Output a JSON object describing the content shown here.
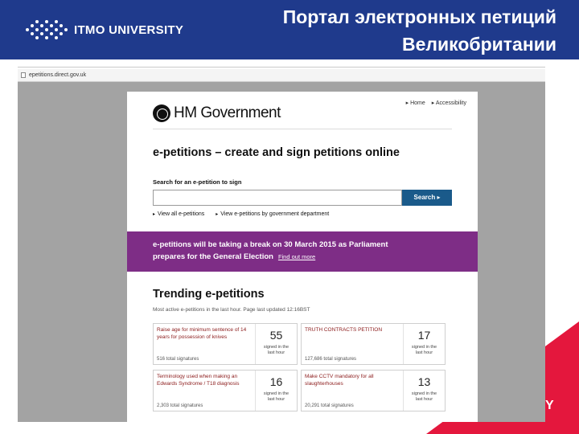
{
  "header": {
    "logo_text": "ITMO UNIVERSITY",
    "title_line1": "Портал электронных петиций",
    "title_line2": "Великобритании",
    "accent_color": "#1f3a8c",
    "corner_letter": "Y"
  },
  "browser": {
    "url": "epetitions.direct.gov.uk"
  },
  "site": {
    "brand": "HM Government",
    "top_links": [
      "Home",
      "Accessibility"
    ],
    "heading": "e-petitions – create and sign petitions online",
    "search_label": "Search for an e-petition to sign",
    "search_value": "",
    "search_button": "Search",
    "browse_links": [
      "View all e-petitions",
      "View e-petitions by government department"
    ],
    "banner_line1": "e-petitions will be taking a break on 30 March 2015 as Parliament",
    "banner_line2": "prepares for the General Election",
    "banner_link": "Find out more",
    "banner_color": "#7e2d86",
    "trending_heading": "Trending e-petitions",
    "trending_sub": "Most active e-petitions in the last hour. Page last updated 12:16BST"
  },
  "trending": [
    {
      "title": "Raise age for minimum sentence of 14 years for possession of knives",
      "signatures": "516 total signatures",
      "count": "55",
      "count_label": "signed in the last hour"
    },
    {
      "title": "TRUTH CONTRACTS PETITION",
      "signatures": "127,686 total signatures",
      "count": "17",
      "count_label": "signed in the last hour"
    },
    {
      "title": "Terminology used when making an Edwards Syndrome / T18 diagnosis",
      "signatures": "2,303 total signatures",
      "count": "16",
      "count_label": "signed in the last hour"
    },
    {
      "title": "Make CCTV mandatory for all slaughterhouses",
      "signatures": "20,291 total signatures",
      "count": "13",
      "count_label": "signed in the last hour"
    }
  ]
}
